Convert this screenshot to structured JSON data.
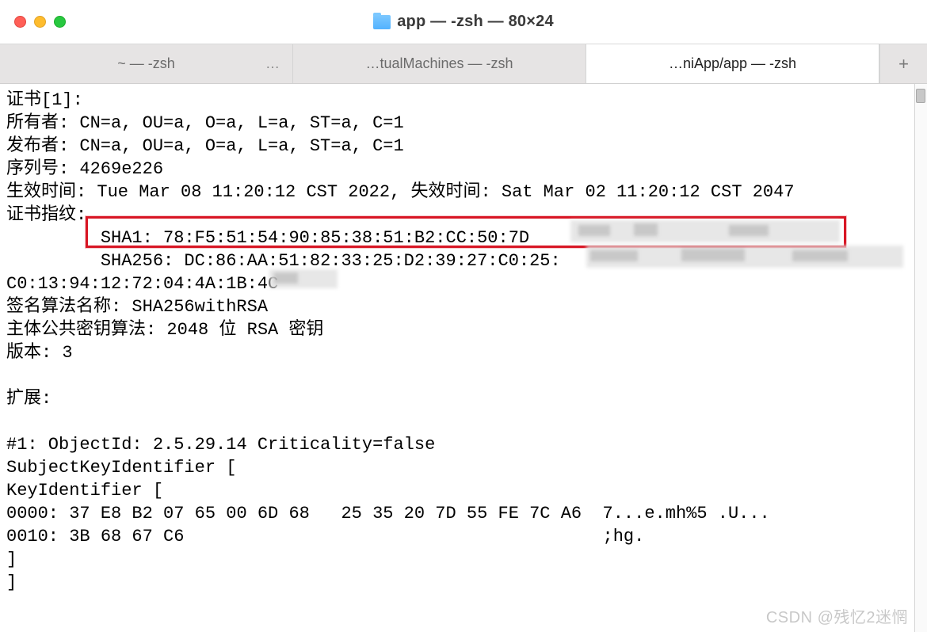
{
  "window": {
    "title": "app — -zsh — 80×24"
  },
  "tabs": [
    {
      "label": "~ — -zsh",
      "active": false,
      "has_ellipsis": true
    },
    {
      "label": "…tualMachines — -zsh",
      "active": false,
      "has_ellipsis": false
    },
    {
      "label": "…niApp/app — -zsh",
      "active": true,
      "has_ellipsis": false
    }
  ],
  "terminal": {
    "lines": [
      "证书[1]:",
      "所有者: CN=a, OU=a, O=a, L=a, ST=a, C=1",
      "发布者: CN=a, OU=a, O=a, L=a, ST=a, C=1",
      "序列号: 4269e226",
      "生效时间: Tue Mar 08 11:20:12 CST 2022, 失效时间: Sat Mar 02 11:20:12 CST 2047",
      "证书指纹:",
      "         SHA1: 78:F5:51:54:90:85:38:51:B2:CC:50:7D",
      "         SHA256: DC:86:AA:51:82:33:25:D2:39:27:C0:25:",
      "C0:13:94:12:72:04:4A:1B:4C",
      "签名算法名称: SHA256withRSA",
      "主体公共密钥算法: 2048 位 RSA 密钥",
      "版本: 3",
      "",
      "扩展: ",
      "",
      "#1: ObjectId: 2.5.29.14 Criticality=false",
      "SubjectKeyIdentifier [",
      "KeyIdentifier [",
      "0000: 37 E8 B2 07 65 00 6D 68   25 35 20 7D 55 FE 7C A6  7...e.mh%5 .U...",
      "0010: 3B 68 67 C6                                        ;hg.",
      "]",
      "]"
    ]
  },
  "new_tab_label": "+",
  "watermark": "CSDN @残忆2迷惘"
}
